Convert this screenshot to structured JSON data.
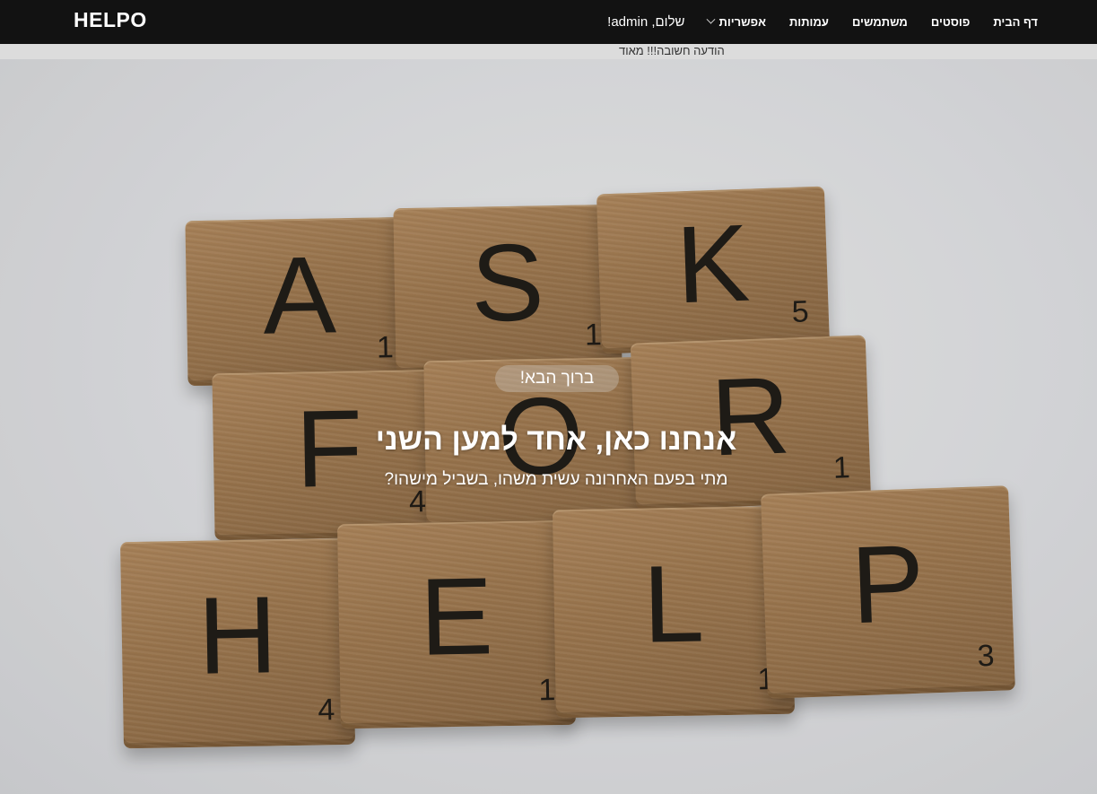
{
  "nav": {
    "brand": "HELPO",
    "greeting": "שלום, admin!",
    "options_label": "אפשריות",
    "items": [
      {
        "label": "עמותות"
      },
      {
        "label": "משתמשים"
      },
      {
        "label": "פוסטים"
      },
      {
        "label": "דף הבית"
      }
    ]
  },
  "notice": "הודעה חשובה!!! מאוד",
  "hero": {
    "welcome": "ברוך הבא!",
    "title": "אנחנו כאן, אחד למען השני",
    "subtitle": "מתי בפעם האחרונה עשית משהו, בשביל מישהו?",
    "tiles": [
      {
        "letter": "A",
        "num": "1"
      },
      {
        "letter": "S",
        "num": "1"
      },
      {
        "letter": "K",
        "num": "5"
      },
      {
        "letter": "F",
        "num": "4"
      },
      {
        "letter": "O",
        "num": ""
      },
      {
        "letter": "R",
        "num": "1"
      },
      {
        "letter": "H",
        "num": "4"
      },
      {
        "letter": "E",
        "num": "1"
      },
      {
        "letter": "L",
        "num": "1"
      },
      {
        "letter": "P",
        "num": "3"
      }
    ]
  }
}
